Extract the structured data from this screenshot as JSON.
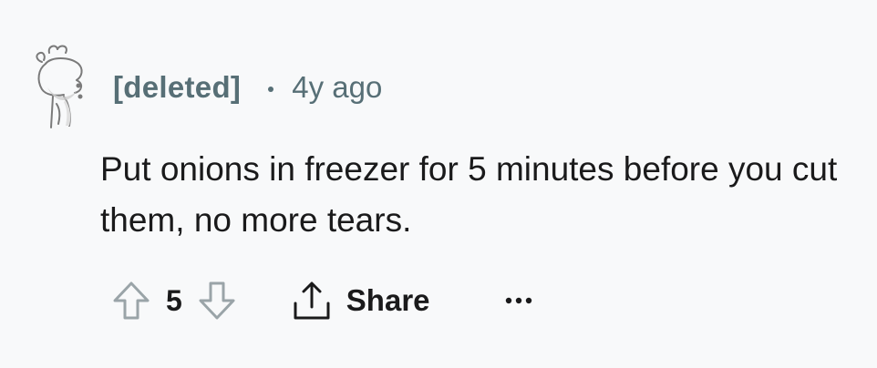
{
  "comment": {
    "author": "[deleted]",
    "age": "4y ago",
    "text": "Put onions in freezer for 5 minutes before you cut them, no more tears.",
    "score": "5"
  },
  "actions": {
    "share_label": "Share"
  },
  "icons": {
    "avatar": "deleted-user-snoo-icon",
    "upvote": "upvote-arrow-icon",
    "downvote": "downvote-arrow-icon",
    "share": "share-icon",
    "more": "more-options-icon"
  },
  "colors": {
    "background": "#f8f9fa",
    "meta_text": "#576f76",
    "body_text": "#1a1a1b",
    "icon_stroke": "#9aa4a8"
  }
}
